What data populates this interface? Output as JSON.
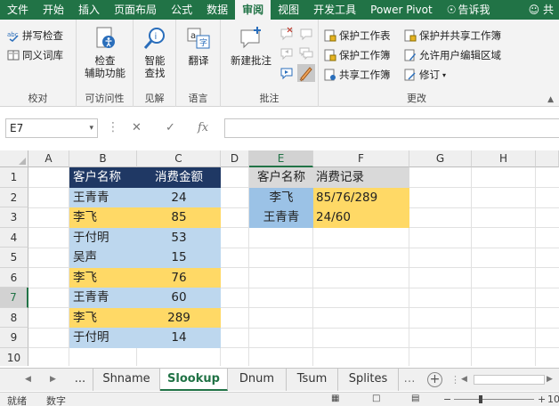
{
  "ribbon": {
    "tabs": [
      "文件",
      "开始",
      "插入",
      "页面布局",
      "公式",
      "数据",
      "审阅",
      "视图",
      "开发工具",
      "Power Pivot",
      "告诉我"
    ],
    "active_tab": "审阅",
    "user_glyph": "共",
    "groups": {
      "proofing": {
        "label": "校对",
        "spell": "拼写检查",
        "thesaurus": "同义词库"
      },
      "accessibility": {
        "label": "可访问性",
        "check_line1": "检查",
        "check_line2": "辅助功能"
      },
      "insights": {
        "label": "见解",
        "smart_line1": "智能",
        "smart_line2": "查找"
      },
      "language": {
        "label": "语言",
        "translate": "翻译"
      },
      "comments": {
        "label": "批注",
        "new_comment": "新建批注"
      },
      "changes": {
        "label": "更改",
        "protect_sheet": "保护工作表",
        "protect_workbook": "保护工作簿",
        "share_workbook": "共享工作簿",
        "protect_share": "保护并共享工作簿",
        "allow_edit": "允许用户编辑区域",
        "track": "修订"
      }
    }
  },
  "formula_bar": {
    "name_box": "E7",
    "fx": "fx",
    "formula": ""
  },
  "sheet": {
    "columns": [
      "A",
      "B",
      "C",
      "D",
      "E",
      "F",
      "G",
      "H"
    ],
    "rows": [
      "1",
      "2",
      "3",
      "4",
      "5",
      "6",
      "7",
      "8",
      "9",
      "10"
    ],
    "table1": {
      "header_name": "客户名称",
      "header_amount": "消费金额",
      "rows": [
        {
          "name": "王青青",
          "amount": "24"
        },
        {
          "name": "李飞",
          "amount": "85"
        },
        {
          "name": "于付明",
          "amount": "53"
        },
        {
          "name": "吴声",
          "amount": "15"
        },
        {
          "name": "李飞",
          "amount": "76"
        },
        {
          "name": "王青青",
          "amount": "60"
        },
        {
          "name": "李飞",
          "amount": "289"
        },
        {
          "name": "于付明",
          "amount": "14"
        }
      ]
    },
    "table2": {
      "header_name": "客户名称",
      "header_record": "消费记录",
      "rows": [
        {
          "name": "李飞",
          "record": "85/76/289"
        },
        {
          "name": "王青青",
          "record": "24/60"
        }
      ]
    }
  },
  "sheet_tabs": {
    "ellipsis": "...",
    "tabs": [
      "Shname",
      "Slookup",
      "Dnum",
      "Tsum",
      "Splites"
    ],
    "active": "Slookup",
    "add": "+"
  },
  "status_bar": {
    "ready": "就绪",
    "numlock": "数字",
    "zoom": "10"
  },
  "colors": {
    "excel_green": "#217346",
    "header_navy": "#1f3864",
    "light_blue": "#bdd7ee",
    "gold": "#ffd966",
    "gray_header": "#d9d9d9",
    "blue_cell": "#9bc2e6"
  }
}
